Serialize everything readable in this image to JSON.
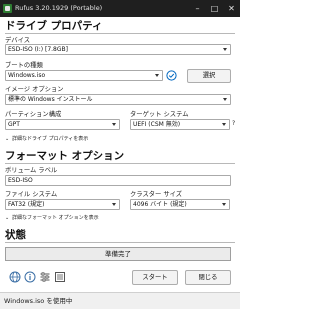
{
  "window": {
    "title": "Rufus 3.20.1929 (Portable)"
  },
  "drive_props": {
    "heading": "ドライブ プロパティ",
    "device_label": "デバイス",
    "device_value": "ESD-ISO (I:) [7.8GB]",
    "boot_type_label": "ブートの種類",
    "boot_type_value": "Windows.iso",
    "select_button": "選択",
    "image_option_label": "イメージ オプション",
    "image_option_value": "標準の Windows インストール",
    "partition_label": "パーティション構成",
    "partition_value": "GPT",
    "target_label": "ターゲット システム",
    "target_value": "UEFI (CSM 無効)",
    "advanced_toggle": "詳細なドライブ プロパティを表示"
  },
  "format_opts": {
    "heading": "フォーマット オプション",
    "volume_label": "ボリューム ラベル",
    "volume_value": "ESD-ISO",
    "fs_label": "ファイル システム",
    "fs_value": "FAT32 (規定)",
    "cluster_label": "クラスター サイズ",
    "cluster_value": "4096 バイト (規定)",
    "advanced_toggle": "詳細なフォーマット オプションを表示"
  },
  "status": {
    "heading": "状態",
    "progress_text": "準備完了"
  },
  "actions": {
    "start": "スタート",
    "close": "閉じる"
  },
  "statusbar": {
    "text": "Windows.iso を使用中"
  },
  "colors": {
    "titlebar": "#1f1f1f",
    "check": "#0067c0",
    "progress_border": "#9e9e9e"
  }
}
